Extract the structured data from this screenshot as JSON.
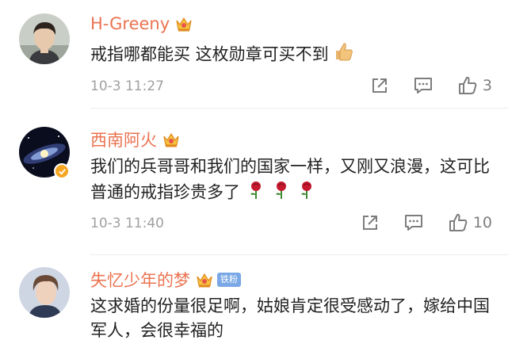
{
  "comments": [
    {
      "username": "H-Greeny",
      "text": "戒指哪都能买 这枚勋章可买不到",
      "timestamp": "10-3 11:27",
      "likes": "3",
      "emoji": "thumbs-up-emoji"
    },
    {
      "username": "西南阿火",
      "text": "我们的兵哥哥和我们的国家一样，又刚又浪漫，这可比普通的戒指珍贵多了",
      "timestamp": "10-3 11:40",
      "likes": "10",
      "emoji": "rose-emoji",
      "verified": true
    },
    {
      "username": "失忆少年的梦",
      "fan_badge": "铁粉",
      "text": "这求婚的份量很足啊，姑娘肯定很受感动了，嫁给中国军人，会很幸福的"
    }
  ],
  "colors": {
    "username": "#eb7350",
    "text": "#222222",
    "meta": "#a0a0a0",
    "icon": "#7d7d7d",
    "divider": "#ececec"
  }
}
